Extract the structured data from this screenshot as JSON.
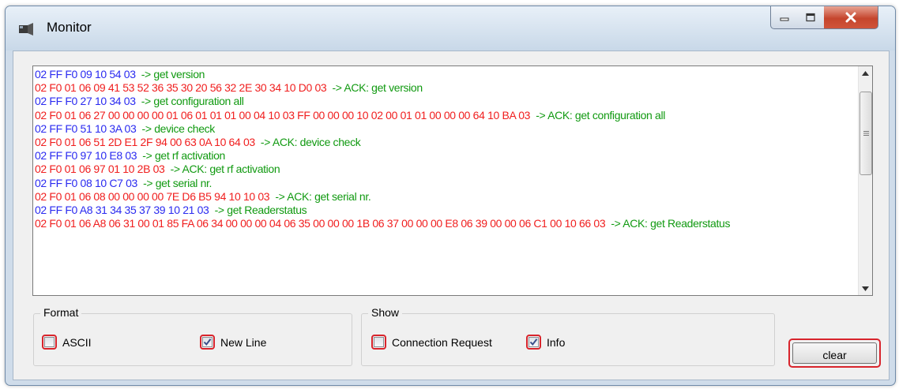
{
  "window": {
    "title": "Monitor"
  },
  "log": [
    {
      "hex": "02 FF F0 09 10 54 03",
      "color": "blue",
      "desc": "-> get version"
    },
    {
      "hex": "02 F0 01 06 09 41 53 52 36 35 30 20 56 32 2E 30 34 10 D0 03",
      "color": "red",
      "desc": "-> ACK: get version"
    },
    {
      "hex": "02 FF F0 27 10 34 03",
      "color": "blue",
      "desc": "-> get configuration all"
    },
    {
      "hex": "02 F0 01 06 27 00 00 00 00 01 06 01 01 01 00 04 10 03 FF 00 00 00 10 02 00 01 01 00 00 00 64 10 BA 03",
      "color": "red",
      "desc": "-> ACK: get configuration all"
    },
    {
      "hex": "02 FF F0 51 10 3A 03",
      "color": "blue",
      "desc": "-> device check"
    },
    {
      "hex": "02 F0 01 06 51 2D E1 2F 94 00 63 0A 10 64 03",
      "color": "red",
      "desc": "-> ACK: device check"
    },
    {
      "hex": "02 FF F0 97 10 E8 03",
      "color": "blue",
      "desc": "-> get rf activation"
    },
    {
      "hex": "02 F0 01 06 97 01 10 2B 03",
      "color": "red",
      "desc": "-> ACK: get rf activation"
    },
    {
      "hex": "02 FF F0 08 10 C7 03",
      "color": "blue",
      "desc": "-> get serial nr."
    },
    {
      "hex": "02 F0 01 06 08 00 00 00 00 7E D6 B5 94 10 10 03",
      "color": "red",
      "desc": "-> ACK: get serial nr."
    },
    {
      "hex": "02 FF F0 A8 31 34 35 37 39 10 21 03",
      "color": "blue",
      "desc": "-> get Readerstatus"
    },
    {
      "hex": "02 F0 01 06 A8 06 31 00 01 85 FA 06 34 00 00 00 04 06 35 00 00 00 1B 06 37 00 00 00 E8 06 39 00 00 06 C1 00 10 66 03",
      "color": "red",
      "desc": "-> ACK: get Readerstatus"
    }
  ],
  "format": {
    "title": "Format",
    "ascii": {
      "label": "ASCII",
      "checked": false
    },
    "new_line": {
      "label": "New Line",
      "checked": true
    }
  },
  "show": {
    "title": "Show",
    "connection_request": {
      "label": "Connection Request",
      "checked": false
    },
    "info": {
      "label": "Info",
      "checked": true
    }
  },
  "buttons": {
    "clear": "clear"
  },
  "colors": {
    "blue": "#2a2af0",
    "red": "#f01e1e",
    "green": "#119a11",
    "highlight": "#d8242c"
  }
}
